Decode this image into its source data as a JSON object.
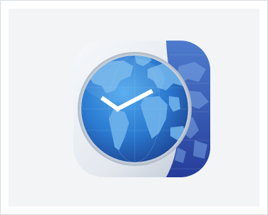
{
  "app_icon": {
    "name": "world-clock-app-icon",
    "glyph": "world-clock-icon"
  },
  "colors": {
    "page_background": "#ffffff",
    "inner_background": "#f3f4f6",
    "frame_border": "#d8dde1",
    "icon_silver_light": "#f4f6f9",
    "icon_silver_dark": "#b9c3cf",
    "globe_blue_light": "#2f8fde",
    "globe_blue_dark": "#1d3f8a",
    "land_blue": "#6fb4ea",
    "band_blue_light": "#4d7fce",
    "band_blue_dark": "#2a45a3",
    "clock_hands": "#ffffff"
  },
  "clock": {
    "hour_hand_position": "10",
    "minute_hand_position": "2"
  }
}
